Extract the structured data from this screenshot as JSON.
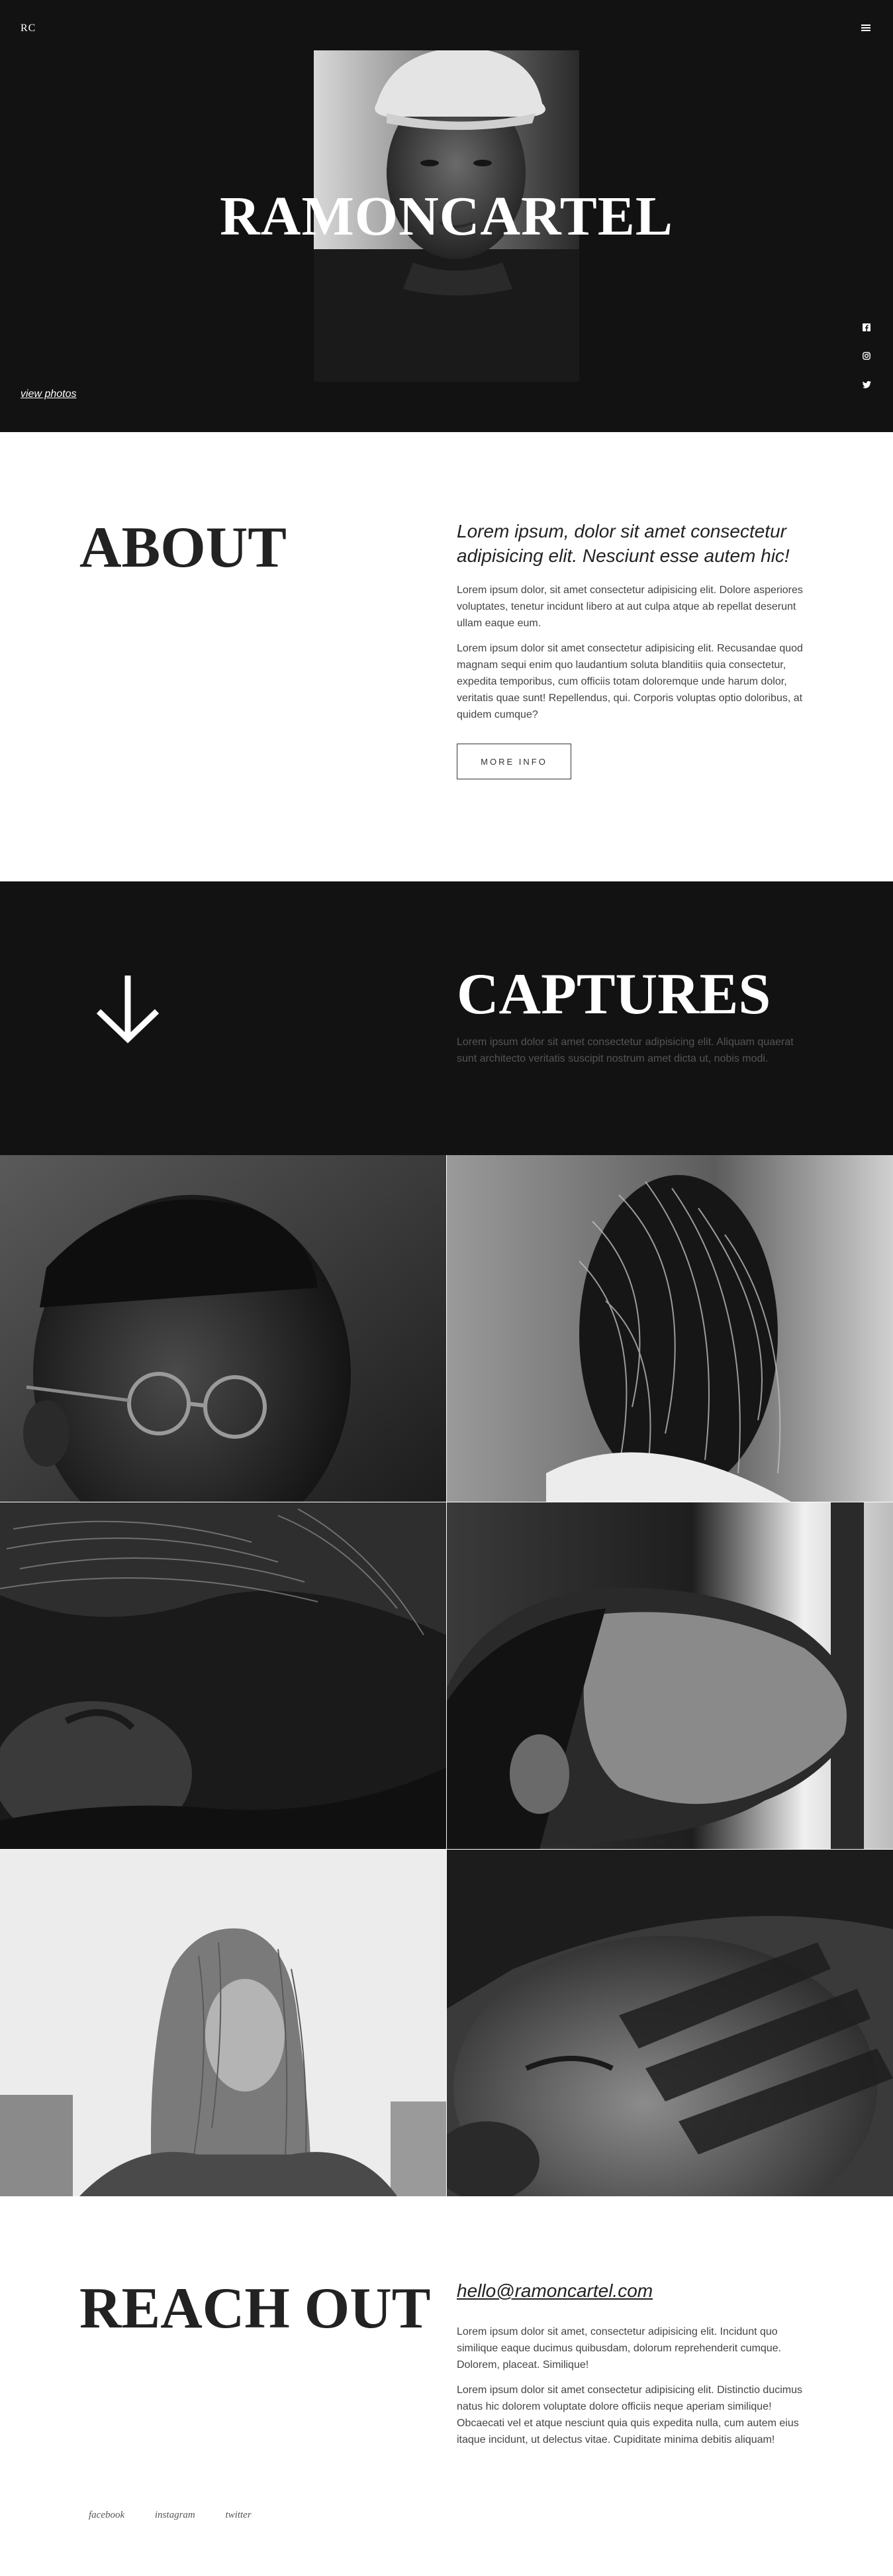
{
  "header": {
    "logo": "RC",
    "menu_icon": "hamburger-icon"
  },
  "hero": {
    "title": "RAMONCARTEL",
    "view_photos_link": "view photos",
    "social_icons": [
      "facebook-icon",
      "instagram-icon",
      "twitter-icon"
    ]
  },
  "about": {
    "title": "ABOUT",
    "lead": "Lorem ipsum, dolor sit amet consectetur adipisicing elit. Nesciunt esse autem hic!",
    "paragraph_1": "Lorem ipsum dolor, sit amet consectetur adipisicing elit. Dolore asperiores voluptates, tenetur incidunt libero at aut culpa atque ab repellat deserunt ullam eaque eum.",
    "paragraph_2": "Lorem ipsum dolor sit amet consectetur adipisicing elit. Recusandae quod magnam sequi enim quo laudantium soluta blanditiis quia consectetur, expedita temporibus, cum officiis totam doloremque unde harum dolor, veritatis quae sunt! Repellendus, qui. Corporis voluptas optio doloribus, at quidem cumque?",
    "more_button": "MORE INFO"
  },
  "captures": {
    "title": "CAPTURES",
    "subtitle": "Lorem ipsum dolor sit amet consectetur adipisicing elit. Aliquam quaerat sunt architecto veritatis suscipit nostrum amet dicta ut, nobis modi.",
    "arrow_icon": "arrow-down-icon"
  },
  "contact": {
    "title": "REACH OUT",
    "email": "hello@ramoncartel.com",
    "paragraph_1": "Lorem ipsum dolor sit amet, consectetur adipisicing elit. Incidunt quo similique eaque ducimus quibusdam, dolorum reprehenderit cumque. Dolorem, placeat. Similique!",
    "paragraph_2": "Lorem ipsum dolor sit amet consectetur adipisicing elit. Distinctio ducimus natus hic dolorem voluptate dolore officiis neque aperiam similique! Obcaecati vel et atque nesciunt quia quis expedita nulla, cum autem eius itaque incidunt, ut delectus vitae. Cupiditate minima debitis aliquam!"
  },
  "footer": {
    "links": [
      "facebook",
      "instagram",
      "twitter"
    ]
  },
  "colors": {
    "dark_background": "#121212",
    "light_background": "#ffffff",
    "text_dark": "#222222",
    "text_muted": "#555555"
  }
}
